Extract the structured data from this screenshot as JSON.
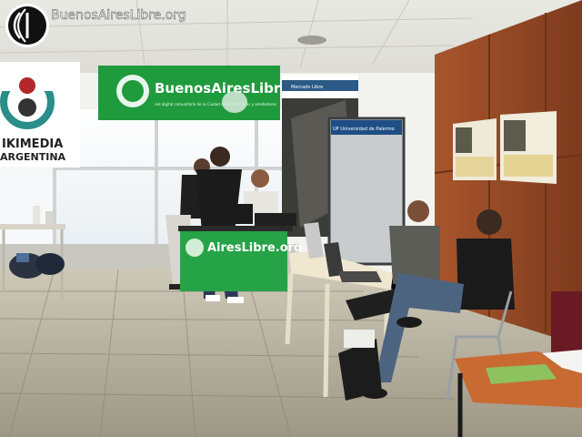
{
  "watermark": {
    "text": "BuenosAiresLibre.org"
  },
  "banner_green": {
    "brand": "BuenosAiresLibre.org",
    "tagline": "red digital comunitaria de la Ciudad de Buenos Aires y alrededores"
  },
  "banner_wikimedia": {
    "line1": "IKIMEDIA",
    "line2": "ARGENTINA"
  },
  "banner_standee": {
    "label": "Mercado Libre"
  },
  "banner_up": {
    "label": "UP  Universidad de Palermo"
  },
  "table_banner": {
    "text": "AiresLibre.org"
  },
  "colors": {
    "brand_green": "#1f9a3c",
    "wall": "#f2f2ee",
    "wood": "#9a4e2a",
    "floor": "#b9b3a1"
  }
}
